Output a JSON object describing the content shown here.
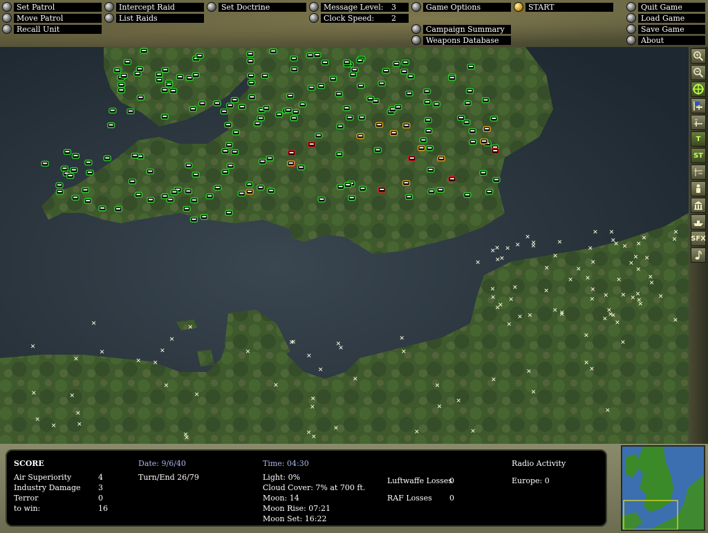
{
  "menu": {
    "set_patrol": "Set Patrol",
    "move_patrol": "Move Patrol",
    "recall_unit": "Recall Unit",
    "intercept_raid": "Intercept Raid",
    "list_raids": "List Raids",
    "set_doctrine": "Set Doctrine",
    "message_level_label": "Message Level:",
    "message_level_value": "3",
    "clock_speed_label": "Clock Speed:",
    "clock_speed_value": "2",
    "game_options": "Game Options",
    "start": "START",
    "campaign_summary": "Campaign Summary",
    "weapons_database": "Weapons Database",
    "quit_game": "Quit Game",
    "load_game": "Load Game",
    "save_game": "Save Game",
    "about": "About"
  },
  "tools": [
    "zoom-in-icon",
    "zoom-out-icon",
    "crosshair-icon",
    "flag-icon",
    "airfield-icon",
    "T",
    "ST",
    "grid-icon",
    "person-icon",
    "building-icon",
    "ship-icon",
    "SFX",
    "music-note-icon"
  ],
  "score": {
    "heading": "SCORE",
    "air_superiority_label": "Air Superiority",
    "air_superiority_value": "4",
    "industry_damage_label": "Industry Damage",
    "industry_damage_value": "3",
    "terror_label": "Terror",
    "terror_value": "0",
    "to_win_label": "to win:",
    "to_win_value": "16"
  },
  "status": {
    "date": "Date: 9/6/40",
    "turn_end": "Turn/End  26/79",
    "time": "Time: 04:30",
    "light": "Light: 0%",
    "cloud_cover": "Cloud Cover: 7% at 700 ft.",
    "moon": "Moon: 14",
    "moon_rise": "Moon Rise: 07:21",
    "moon_set": "Moon Set: 16:22",
    "luftwaffe_losses_label": "Luftwaffe Losses",
    "luftwaffe_losses_value": "0",
    "raf_losses_label": "RAF Losses",
    "raf_losses_value": "0",
    "radio_activity": "Radio Activity",
    "europe": "Europe: 0"
  },
  "colors": {
    "raf_unit": "#2fd02f",
    "damaged_unit": "#e8a020",
    "destroyed_unit": "#e01818",
    "enemy_airfield": "#ffffe0",
    "sea": "#2c3840",
    "land": "#3e5a2c"
  }
}
